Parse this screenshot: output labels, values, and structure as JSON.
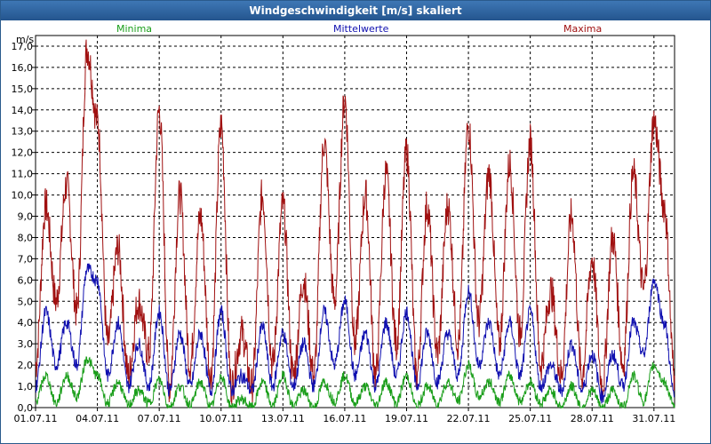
{
  "window": {
    "title": "Windgeschwindigkeit [m/s] skaliert"
  },
  "legend": [
    {
      "name": "Minima",
      "color": "#1a9e1a"
    },
    {
      "name": "Mittelwerte",
      "color": "#1010b0"
    },
    {
      "name": "Maxima",
      "color": "#a01010"
    }
  ],
  "chart_data": {
    "type": "line",
    "ylabel": "m/s",
    "ylim": [
      0,
      17.5
    ],
    "xlim_days": [
      1,
      32
    ],
    "grid": true,
    "yticks": [
      "0,0",
      "1,0",
      "2,0",
      "3,0",
      "4,0",
      "5,0",
      "6,0",
      "7,0",
      "8,0",
      "9,0",
      "10,0",
      "11,0",
      "12,0",
      "13,0",
      "14,0",
      "15,0",
      "16,0",
      "17,0"
    ],
    "xticks": [
      "01.07.11",
      "04.07.11",
      "07.07.11",
      "10.07.11",
      "13.07.11",
      "16.07.11",
      "19.07.11",
      "22.07.11",
      "25.07.11",
      "28.07.11",
      "31.07.11"
    ],
    "series": [
      {
        "name": "Maxima",
        "color": "#a01010",
        "x": [
          "01.07.11 00:00",
          "01.07.11 12:00",
          "02.07.11 00:00",
          "02.07.11 12:00",
          "03.07.11 00:00",
          "03.07.11 12:00",
          "04.07.11 00:00",
          "04.07.11 12:00",
          "05.07.11 00:00",
          "05.07.11 12:00",
          "06.07.11 00:00",
          "06.07.11 12:00",
          "07.07.11 00:00",
          "07.07.11 12:00",
          "08.07.11 00:00",
          "08.07.11 12:00",
          "09.07.11 00:00",
          "09.07.11 12:00",
          "10.07.11 00:00",
          "10.07.11 12:00",
          "11.07.11 00:00",
          "11.07.11 12:00",
          "12.07.11 00:00",
          "12.07.11 12:00",
          "13.07.11 00:00",
          "13.07.11 12:00",
          "14.07.11 00:00",
          "14.07.11 12:00",
          "15.07.11 00:00",
          "15.07.11 12:00",
          "16.07.11 00:00",
          "16.07.11 12:00",
          "17.07.11 00:00",
          "17.07.11 12:00",
          "18.07.11 00:00",
          "18.07.11 12:00",
          "19.07.11 00:00",
          "19.07.11 12:00",
          "20.07.11 00:00",
          "20.07.11 12:00",
          "21.07.11 00:00",
          "21.07.11 12:00",
          "22.07.11 00:00",
          "22.07.11 12:00",
          "23.07.11 00:00",
          "23.07.11 12:00",
          "24.07.11 00:00",
          "24.07.11 12:00",
          "25.07.11 00:00",
          "25.07.11 12:00",
          "26.07.11 00:00",
          "26.07.11 12:00",
          "27.07.11 00:00",
          "27.07.11 12:00",
          "28.07.11 00:00",
          "28.07.11 12:00",
          "29.07.11 00:00",
          "29.07.11 12:00",
          "30.07.11 00:00",
          "30.07.11 12:00",
          "31.07.11 00:00",
          "31.07.11 12:00",
          "01.08.11 00:00"
        ],
        "values": [
          2.0,
          9.5,
          5.0,
          10.5,
          4.5,
          16.9,
          13.5,
          3.0,
          7.5,
          1.5,
          5.0,
          2.5,
          14.0,
          1.0,
          10.0,
          2.0,
          9.0,
          1.5,
          13.3,
          1.0,
          3.5,
          1.0,
          10.0,
          2.0,
          9.5,
          1.5,
          6.0,
          1.5,
          12.5,
          5.0,
          14.5,
          3.0,
          10.0,
          1.5,
          11.0,
          3.0,
          12.0,
          1.5,
          9.5,
          2.5,
          9.5,
          3.0,
          13.3,
          4.0,
          11.0,
          3.0,
          11.5,
          3.5,
          12.5,
          2.0,
          5.5,
          1.5,
          9.0,
          1.5,
          7.0,
          1.0,
          8.0,
          2.0,
          11.0,
          5.5,
          13.5,
          9.5,
          1.5
        ]
      },
      {
        "name": "Mittelwerte",
        "color": "#1010b0",
        "x": [
          "01.07.11 00:00",
          "01.07.11 12:00",
          "02.07.11 00:00",
          "02.07.11 12:00",
          "03.07.11 00:00",
          "03.07.11 12:00",
          "04.07.11 00:00",
          "04.07.11 12:00",
          "05.07.11 00:00",
          "05.07.11 12:00",
          "06.07.11 00:00",
          "06.07.11 12:00",
          "07.07.11 00:00",
          "07.07.11 12:00",
          "08.07.11 00:00",
          "08.07.11 12:00",
          "09.07.11 00:00",
          "09.07.11 12:00",
          "10.07.11 00:00",
          "10.07.11 12:00",
          "11.07.11 00:00",
          "11.07.11 12:00",
          "12.07.11 00:00",
          "12.07.11 12:00",
          "13.07.11 00:00",
          "13.07.11 12:00",
          "14.07.11 00:00",
          "14.07.11 12:00",
          "15.07.11 00:00",
          "15.07.11 12:00",
          "16.07.11 00:00",
          "16.07.11 12:00",
          "17.07.11 00:00",
          "17.07.11 12:00",
          "18.07.11 00:00",
          "18.07.11 12:00",
          "19.07.11 00:00",
          "19.07.11 12:00",
          "20.07.11 00:00",
          "20.07.11 12:00",
          "21.07.11 00:00",
          "21.07.11 12:00",
          "22.07.11 00:00",
          "22.07.11 12:00",
          "23.07.11 00:00",
          "23.07.11 12:00",
          "24.07.11 00:00",
          "24.07.11 12:00",
          "25.07.11 00:00",
          "25.07.11 12:00",
          "26.07.11 00:00",
          "26.07.11 12:00",
          "27.07.11 00:00",
          "27.07.11 12:00",
          "28.07.11 00:00",
          "28.07.11 12:00",
          "29.07.11 00:00",
          "29.07.11 12:00",
          "30.07.11 00:00",
          "30.07.11 12:00",
          "31.07.11 00:00",
          "31.07.11 12:00",
          "01.08.11 00:00"
        ],
        "values": [
          1.0,
          4.5,
          2.0,
          4.0,
          2.0,
          6.5,
          6.0,
          1.5,
          4.0,
          1.0,
          3.0,
          1.0,
          4.5,
          0.8,
          3.5,
          1.0,
          3.5,
          0.8,
          4.5,
          0.8,
          1.5,
          0.8,
          3.8,
          1.0,
          3.5,
          1.0,
          3.0,
          1.0,
          4.5,
          2.0,
          5.0,
          1.5,
          3.5,
          1.0,
          4.0,
          1.5,
          4.5,
          1.0,
          3.5,
          1.2,
          3.5,
          1.5,
          5.5,
          2.0,
          4.0,
          1.5,
          4.0,
          1.5,
          4.5,
          1.0,
          2.0,
          0.8,
          3.0,
          0.8,
          2.5,
          0.5,
          2.5,
          1.0,
          4.0,
          2.5,
          6.0,
          4.0,
          0.5
        ]
      },
      {
        "name": "Minima",
        "color": "#1a9e1a",
        "x": [
          "01.07.11 00:00",
          "01.07.11 12:00",
          "02.07.11 00:00",
          "02.07.11 12:00",
          "03.07.11 00:00",
          "03.07.11 12:00",
          "04.07.11 00:00",
          "04.07.11 12:00",
          "05.07.11 00:00",
          "05.07.11 12:00",
          "06.07.11 00:00",
          "06.07.11 12:00",
          "07.07.11 00:00",
          "07.07.11 12:00",
          "08.07.11 00:00",
          "08.07.11 12:00",
          "09.07.11 00:00",
          "09.07.11 12:00",
          "10.07.11 00:00",
          "10.07.11 12:00",
          "11.07.11 00:00",
          "11.07.11 12:00",
          "12.07.11 00:00",
          "12.07.11 12:00",
          "13.07.11 00:00",
          "13.07.11 12:00",
          "14.07.11 00:00",
          "14.07.11 12:00",
          "15.07.11 00:00",
          "15.07.11 12:00",
          "16.07.11 00:00",
          "16.07.11 12:00",
          "17.07.11 00:00",
          "17.07.11 12:00",
          "18.07.11 00:00",
          "18.07.11 12:00",
          "19.07.11 00:00",
          "19.07.11 12:00",
          "20.07.11 00:00",
          "20.07.11 12:00",
          "21.07.11 00:00",
          "21.07.11 12:00",
          "22.07.11 00:00",
          "22.07.11 12:00",
          "23.07.11 00:00",
          "23.07.11 12:00",
          "24.07.11 00:00",
          "24.07.11 12:00",
          "25.07.11 00:00",
          "25.07.11 12:00",
          "26.07.11 00:00",
          "26.07.11 12:00",
          "27.07.11 00:00",
          "27.07.11 12:00",
          "28.07.11 00:00",
          "28.07.11 12:00",
          "29.07.11 00:00",
          "29.07.11 12:00",
          "30.07.11 00:00",
          "30.07.11 12:00",
          "31.07.11 00:00",
          "31.07.11 12:00",
          "01.08.11 00:00"
        ],
        "values": [
          0.3,
          1.5,
          0.2,
          1.5,
          0.5,
          2.3,
          1.5,
          0.2,
          1.2,
          0.1,
          0.8,
          0.2,
          1.3,
          0.0,
          1.0,
          0.1,
          1.2,
          0.0,
          1.5,
          0.0,
          0.4,
          0.0,
          1.2,
          0.1,
          1.5,
          0.1,
          0.8,
          0.0,
          1.2,
          0.3,
          1.5,
          0.2,
          1.0,
          0.1,
          1.2,
          0.2,
          1.5,
          0.0,
          1.0,
          0.2,
          1.2,
          0.3,
          2.0,
          0.5,
          1.2,
          0.3,
          1.5,
          0.3,
          1.2,
          0.2,
          0.8,
          0.0,
          1.0,
          0.0,
          0.8,
          0.0,
          0.8,
          0.0,
          1.5,
          0.3,
          2.0,
          1.2,
          0.0
        ]
      }
    ]
  }
}
